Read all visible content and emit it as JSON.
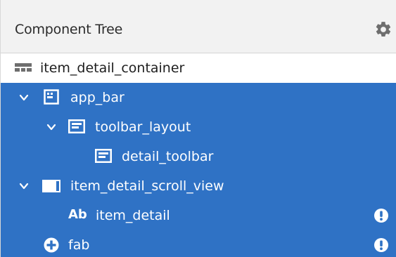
{
  "panel": {
    "title": "Component Tree",
    "settings_icon": "gear-icon"
  },
  "tree": {
    "root": {
      "label": "item_detail_container",
      "icon": "container-layout-icon"
    },
    "items": [
      {
        "label": "app_bar",
        "icon": "appbar-layout-icon",
        "expanded": true,
        "depth": 1,
        "warning": false
      },
      {
        "label": "toolbar_layout",
        "icon": "toolbar-icon",
        "expanded": true,
        "depth": 2,
        "warning": false
      },
      {
        "label": "detail_toolbar",
        "icon": "toolbar-icon",
        "expanded": null,
        "depth": 3,
        "warning": false
      },
      {
        "label": "item_detail_scroll_view",
        "icon": "scrollview-icon",
        "expanded": true,
        "depth": 1,
        "warning": false
      },
      {
        "label": "item_detail",
        "icon": "textview-icon",
        "icon_text": "Ab",
        "expanded": null,
        "depth": 2,
        "warning": true
      },
      {
        "label": "fab",
        "icon": "fab-add-icon",
        "expanded": null,
        "depth": 1,
        "warning": true
      }
    ]
  },
  "colors": {
    "selection": "#2f72c5",
    "header_bg": "#f2f2f2"
  }
}
